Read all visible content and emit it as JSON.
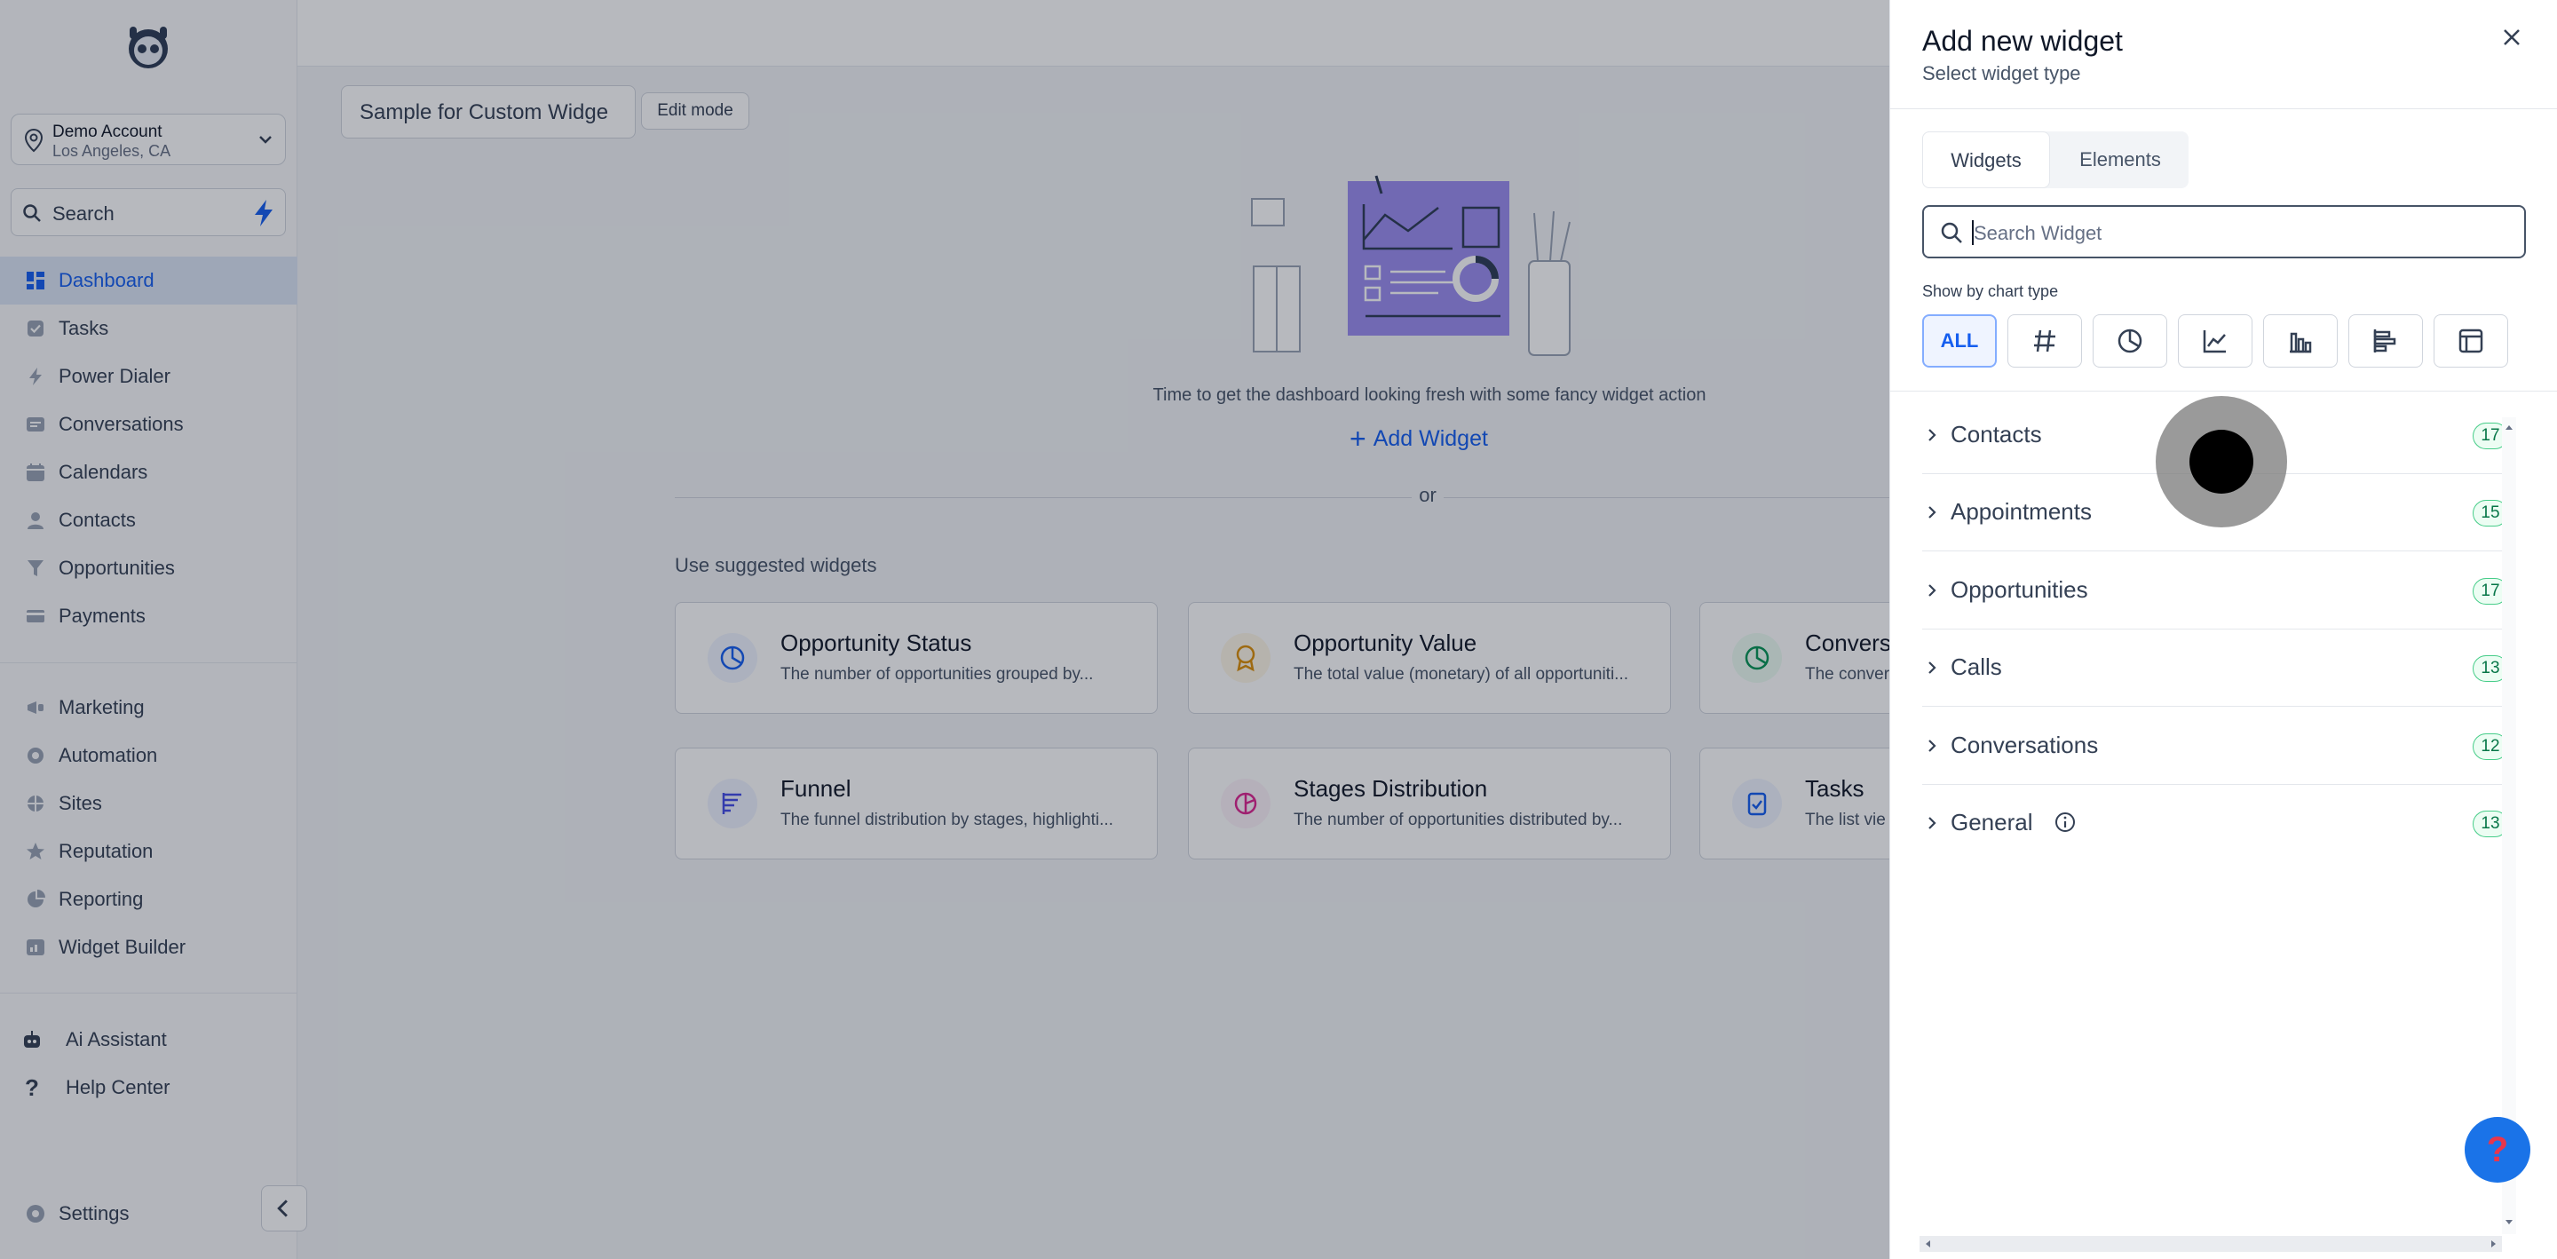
{
  "sidebar": {
    "account": {
      "name": "Demo Account",
      "location": "Los Angeles, CA"
    },
    "search_label": "Search",
    "items": [
      {
        "label": "Dashboard"
      },
      {
        "label": "Tasks"
      },
      {
        "label": "Power Dialer"
      },
      {
        "label": "Conversations"
      },
      {
        "label": "Calendars"
      },
      {
        "label": "Contacts"
      },
      {
        "label": "Opportunities"
      },
      {
        "label": "Payments"
      }
    ],
    "items2": [
      {
        "label": "Marketing"
      },
      {
        "label": "Automation"
      },
      {
        "label": "Sites"
      },
      {
        "label": "Reputation"
      },
      {
        "label": "Reporting"
      },
      {
        "label": "Widget Builder"
      }
    ],
    "items3": [
      {
        "label": "Ai Assistant"
      },
      {
        "label": "Help Center"
      }
    ],
    "settings_label": "Settings"
  },
  "main": {
    "dashboard_name": "Sample for Custom Widge",
    "edit_mode_label": "Edit mode",
    "empty_text": "Time to get the dashboard looking fresh with some fancy widget action",
    "add_widget_label": "Add Widget",
    "or_text": "or",
    "suggested_title": "Use suggested widgets",
    "cards": [
      {
        "title": "Opportunity Status",
        "desc": "The number of opportunities grouped by..."
      },
      {
        "title": "Opportunity Value",
        "desc": "The total value (monetary) of all opportuniti..."
      },
      {
        "title": "Conversi",
        "desc": "The convers"
      },
      {
        "title": "Funnel",
        "desc": "The funnel distribution by stages, highlighti..."
      },
      {
        "title": "Stages Distribution",
        "desc": "The number of opportunities distributed by..."
      },
      {
        "title": "Tasks",
        "desc": "The list vie"
      }
    ]
  },
  "panel": {
    "title": "Add new widget",
    "subtitle": "Select widget type",
    "tabs": [
      "Widgets",
      "Elements"
    ],
    "search_placeholder": "Search Widget",
    "show_by_label": "Show by chart type",
    "all_label": "ALL",
    "categories": [
      {
        "label": "Contacts",
        "count": "17"
      },
      {
        "label": "Appointments",
        "count": "15"
      },
      {
        "label": "Opportunities",
        "count": "17"
      },
      {
        "label": "Calls",
        "count": "13"
      },
      {
        "label": "Conversations",
        "count": "12"
      },
      {
        "label": "General",
        "count": "13"
      }
    ]
  },
  "colors": {
    "accent": "#155eef",
    "badge_green": "#067647",
    "illustration": "#9b8df0"
  }
}
